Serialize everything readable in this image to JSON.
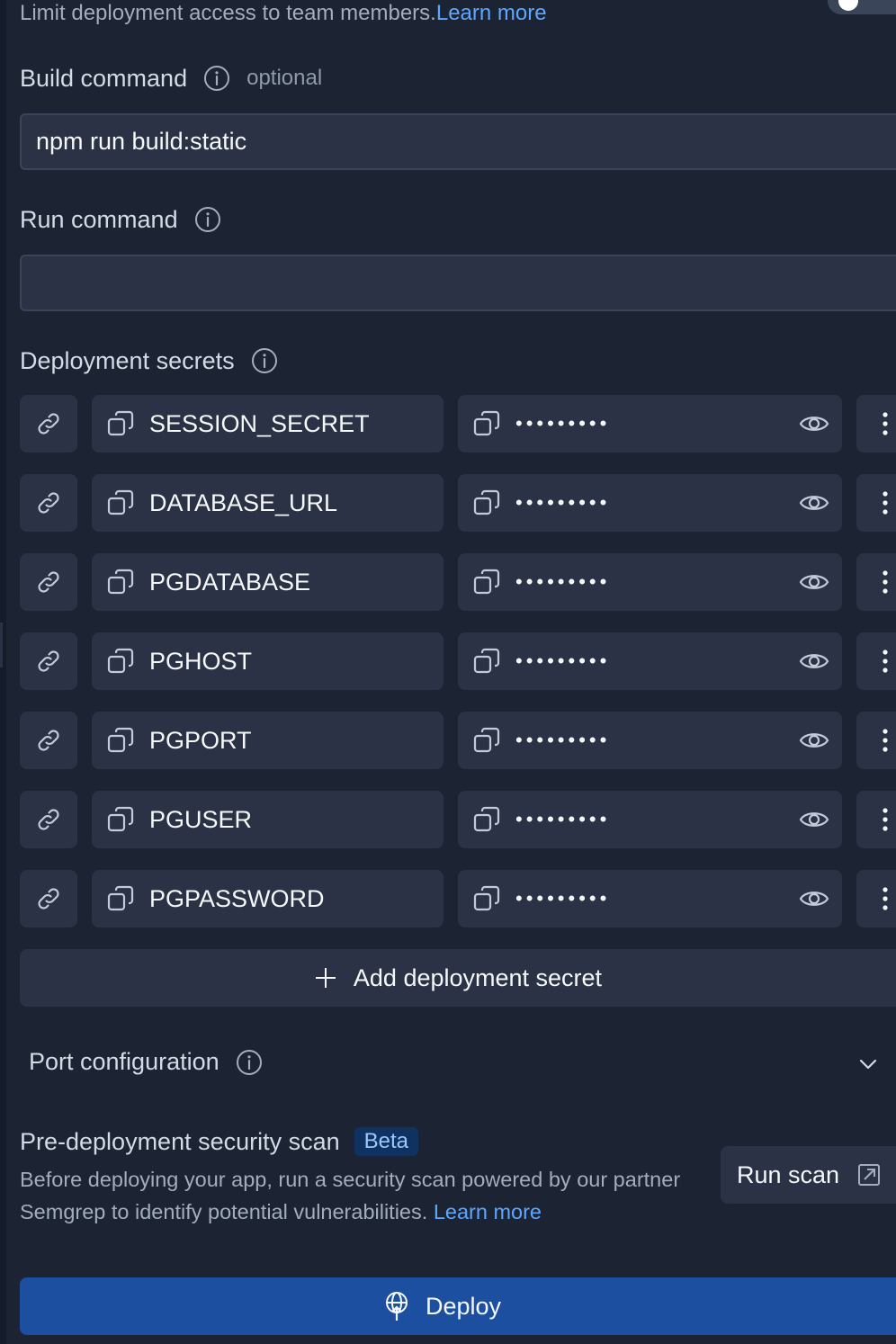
{
  "access": {
    "text": "Limit deployment access to team members.",
    "link": "Learn more"
  },
  "build": {
    "label": "Build command",
    "optional": "optional",
    "value": "npm run build:static"
  },
  "run": {
    "label": "Run command",
    "value": ""
  },
  "secrets": {
    "label": "Deployment secrets",
    "items": [
      {
        "key": "SESSION_SECRET",
        "masked": "•••••••••"
      },
      {
        "key": "DATABASE_URL",
        "masked": "•••••••••"
      },
      {
        "key": "PGDATABASE",
        "masked": "•••••••••"
      },
      {
        "key": "PGHOST",
        "masked": "•••••••••"
      },
      {
        "key": "PGPORT",
        "masked": "•••••••••"
      },
      {
        "key": "PGUSER",
        "masked": "•••••••••"
      },
      {
        "key": "PGPASSWORD",
        "masked": "•••••••••"
      }
    ],
    "add_label": "Add deployment secret"
  },
  "port": {
    "label": "Port configuration"
  },
  "scan": {
    "title": "Pre-deployment security scan",
    "badge": "Beta",
    "description": "Before deploying your app, run a security scan powered by our partner Semgrep to identify potential vulnerabilities. ",
    "link": "Learn more",
    "button": "Run scan"
  },
  "deploy": {
    "label": "Deploy"
  },
  "icons": {
    "info": "info-icon",
    "link": "link-icon",
    "copy": "copy-icon",
    "eye": "eye-icon",
    "more": "more-vertical-icon",
    "plus": "plus-icon",
    "chevron": "chevron-down-icon",
    "external": "external-link-icon",
    "deploy": "globe-deploy-icon"
  },
  "colors": {
    "bg": "#1c2333",
    "surface": "#2b3245",
    "accent": "#5ea7ff",
    "deploy": "#1c4fa0",
    "badge_bg": "#0f3260"
  }
}
